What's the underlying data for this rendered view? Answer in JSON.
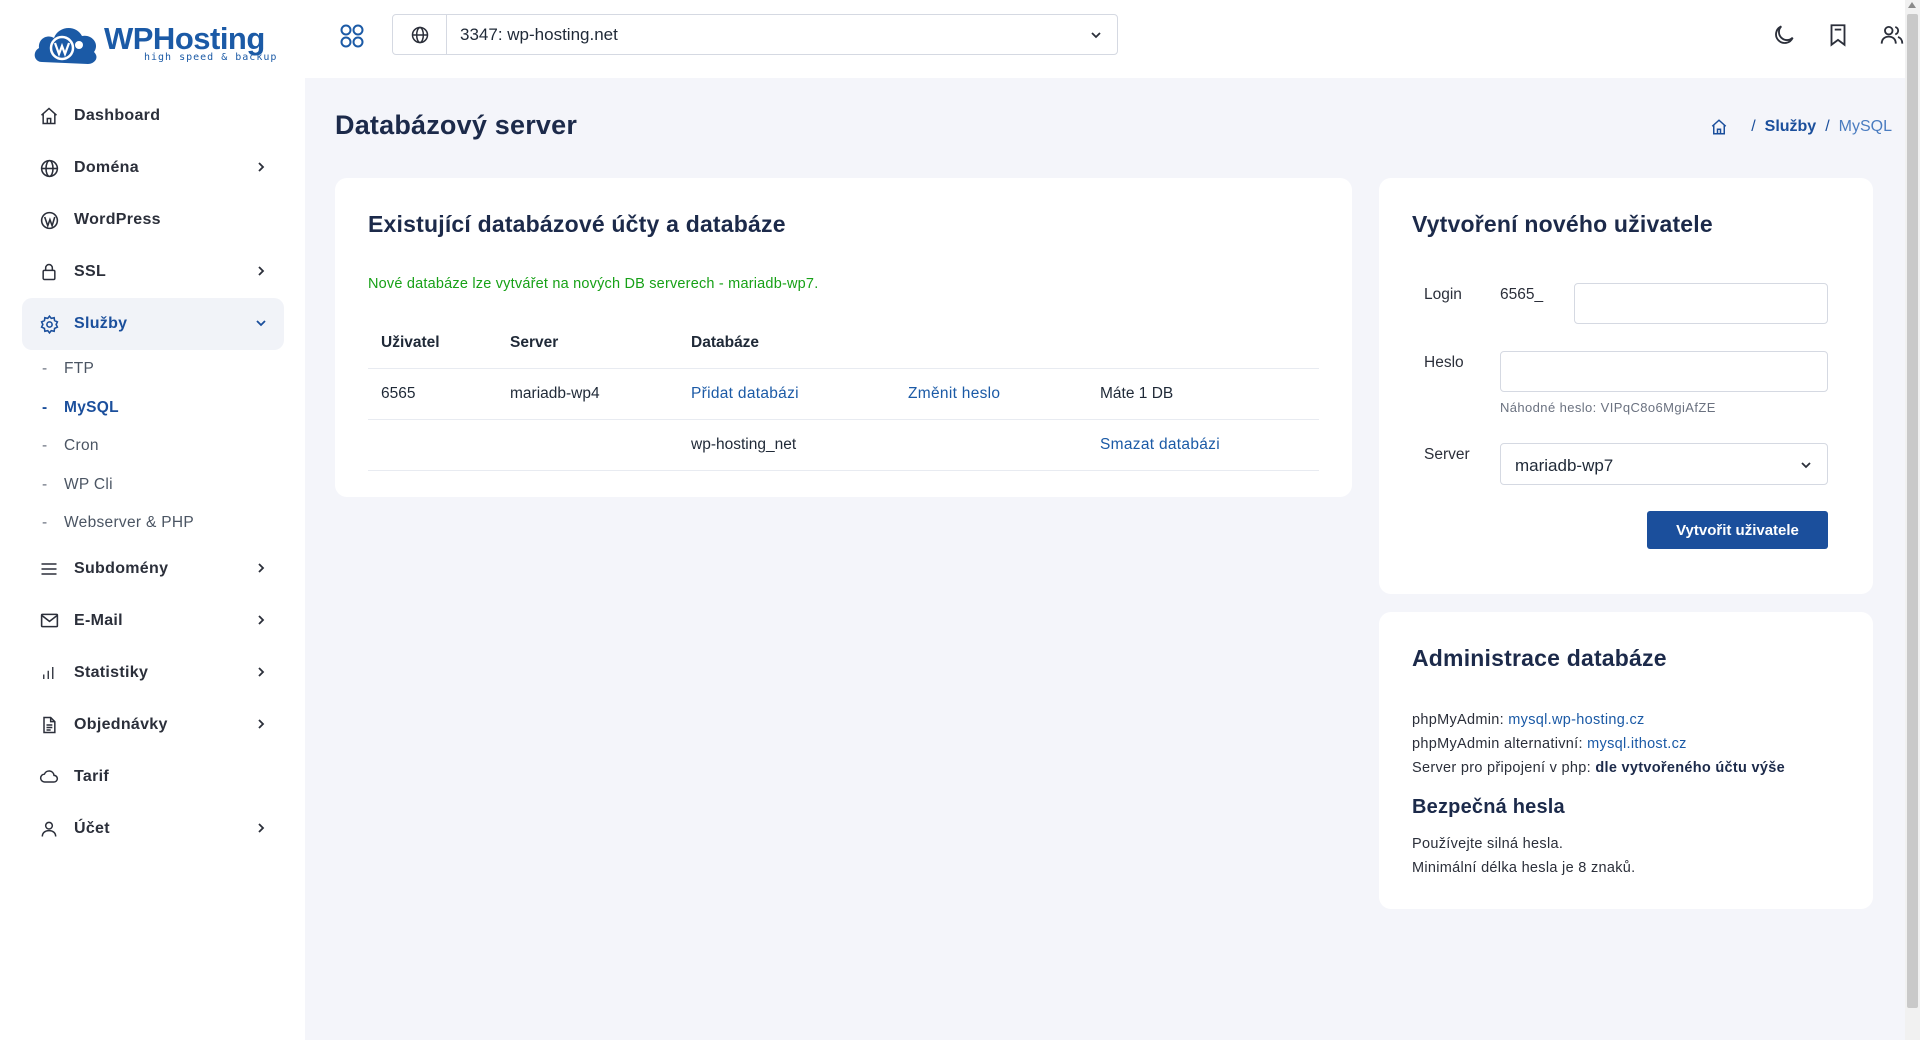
{
  "brand": {
    "name": "WPHosting",
    "tagline": "high speed & backup",
    "color": "#1b5aa6"
  },
  "sidebar": {
    "items": [
      {
        "label": "Dashboard",
        "icon": "home-icon"
      },
      {
        "label": "Doména",
        "icon": "globe-icon"
      },
      {
        "label": "WordPress",
        "icon": "wordpress-icon"
      },
      {
        "label": "SSL",
        "icon": "lock-icon"
      },
      {
        "label": "Služby",
        "icon": "gear-icon"
      },
      {
        "label": "Subdomény",
        "icon": "menu-icon"
      },
      {
        "label": "E-Mail",
        "icon": "mail-icon"
      },
      {
        "label": "Statistiky",
        "icon": "bar-chart-icon"
      },
      {
        "label": "Objednávky",
        "icon": "document-icon"
      },
      {
        "label": "Tarif",
        "icon": "cloud-icon"
      },
      {
        "label": "Účet",
        "icon": "user-icon"
      }
    ],
    "subitems": [
      {
        "label": "FTP"
      },
      {
        "label": "MySQL"
      },
      {
        "label": "Cron"
      },
      {
        "label": "WP Cli"
      },
      {
        "label": "Webserver & PHP"
      }
    ]
  },
  "topbar": {
    "site_select_value": "3347: wp-hosting.net"
  },
  "page": {
    "title": "Databázový server",
    "breadcrumb": {
      "sep": "/",
      "section": "Služby",
      "current": "MySQL"
    }
  },
  "db_card": {
    "title": "Existující databázové účty a databáze",
    "note": "Nové databáze lze vytvářet na nových DB serverech - mariadb-wp7.",
    "headers": {
      "user": "Uživatel",
      "server": "Server",
      "db": "Databáze"
    },
    "rows": [
      {
        "user": "6565",
        "server": "mariadb-wp4",
        "add_db": "Přidat databázi",
        "change_pw": "Změnit heslo",
        "info": "Máte 1 DB"
      },
      {
        "db_name": "wp-hosting_net",
        "delete_db": "Smazat databázi"
      }
    ]
  },
  "user_card": {
    "title": "Vytvoření nového uživatele",
    "login_label": "Login",
    "login_prefix": "6565_",
    "login_value": "",
    "password_label": "Heslo",
    "password_value": "",
    "random_password_hint": "Náhodné heslo: VIPqC8o6MgiAfZE",
    "server_label": "Server",
    "server_value": "mariadb-wp7",
    "create_button": "Vytvořit uživatele"
  },
  "admin_card": {
    "title": "Administrace databáze",
    "pma_label": "phpMyAdmin:",
    "pma_link": "mysql.wp-hosting.cz",
    "pma_alt_label": "phpMyAdmin alternativní:",
    "pma_alt_link": "mysql.ithost.cz",
    "server_conn_label": "Server pro připojení v php:",
    "server_conn_value": "dle vytvořeného účtu výše",
    "secure_title": "Bezpečná hesla",
    "secure_line1": "Používejte silná hesla.",
    "secure_line2": "Minimální délka hesla je 8 znaků."
  },
  "colors": {
    "accent": "#1b4f9c",
    "link": "#1b5aa6",
    "note_green": "#17a117",
    "background": "#f4f5fa"
  }
}
